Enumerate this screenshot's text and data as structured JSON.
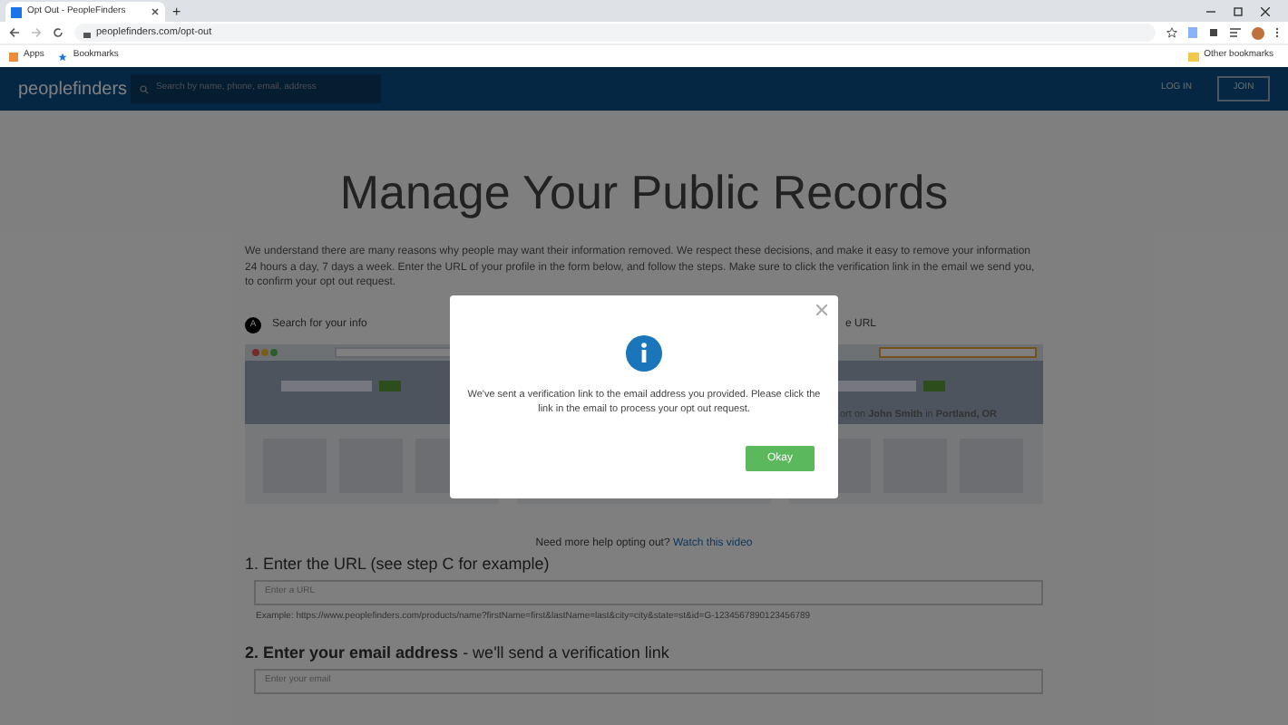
{
  "browser": {
    "tab_title": "Opt Out - PeopleFinders",
    "new_tab": "+",
    "url": "peoplefinders.com/opt-out",
    "bookmarks": [
      "Apps",
      "Bookmarks"
    ],
    "other_bookmarks": "Other bookmarks"
  },
  "nav": {
    "logo": "peoplefinders",
    "search_placeholder": "Search by name, phone, email, address",
    "login": "LOG IN",
    "join": "JOIN"
  },
  "page": {
    "title": "Manage Your Public Records",
    "intro": "We understand there are many reasons why people may want their information removed. We respect these decisions, and make it easy to remove your information 24 hours a day, 7 days a week. Enter the URL of your profile in the form below, and follow the steps. Make sure to click the verification link in the email we send you, to confirm your opt out request.",
    "steps": [
      {
        "letter": "A",
        "label": "Search for your info"
      },
      {
        "label": "e URL"
      }
    ],
    "example_report": "ort on **John Smith** in **Portland, OR**",
    "help": "Need more help opting out?",
    "help_link": "Watch this video",
    "form": [
      {
        "heading": "1. Enter the URL (see step C for example)",
        "placeholder": "Enter a URL",
        "hint": "Example: https://www.peoplefinders.com/products/name?firstName=first&lastName=last&city=city&state=st&id=G-1234567890123456789"
      },
      {
        "heading": "**2. Enter your email address** - we'll send a verification link",
        "placeholder": "Enter your email"
      }
    ]
  },
  "modal": {
    "message": "We've sent a verification link to the email address you provided. Please click the link in the email to process your opt out request.",
    "button": "Okay"
  }
}
